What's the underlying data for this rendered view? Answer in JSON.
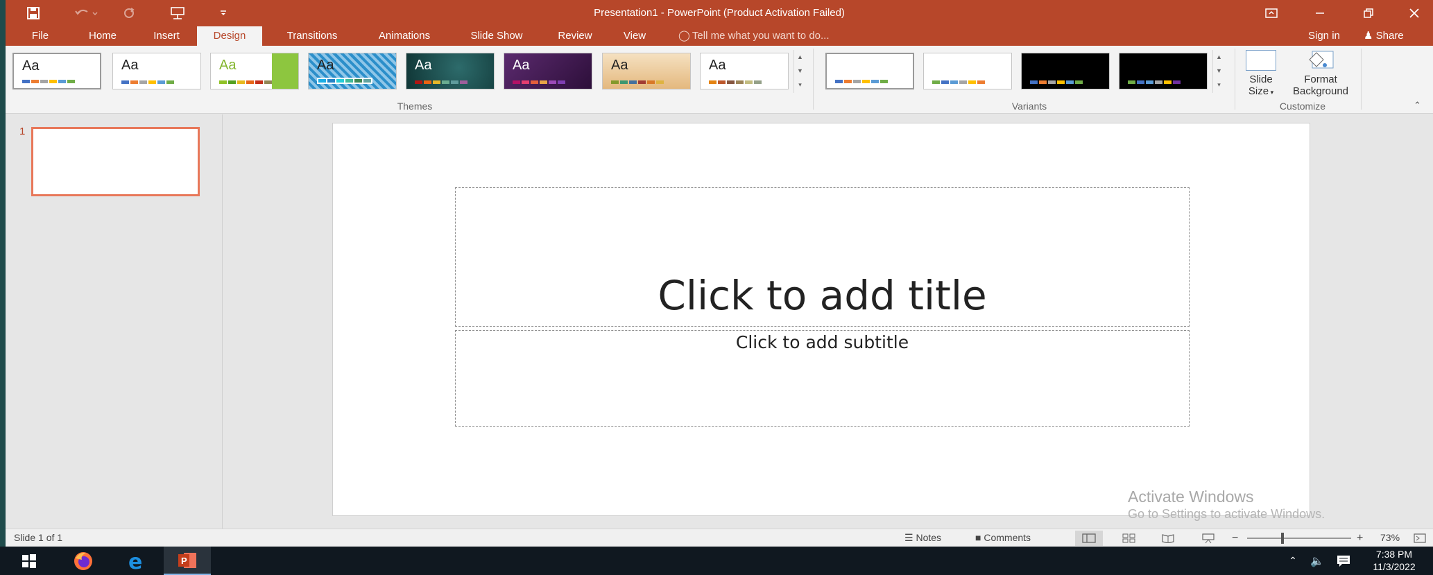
{
  "window": {
    "title": "Presentation1 - PowerPoint (Product Activation Failed)"
  },
  "tabs": [
    {
      "label": "File"
    },
    {
      "label": "Home"
    },
    {
      "label": "Insert"
    },
    {
      "label": "Design"
    },
    {
      "label": "Transitions"
    },
    {
      "label": "Animations"
    },
    {
      "label": "Slide Show"
    },
    {
      "label": "Review"
    },
    {
      "label": "View"
    }
  ],
  "active_tab": "Design",
  "tell_me": "Tell me what you want to do...",
  "sign_in": "Sign in",
  "share": "Share",
  "themes": {
    "group_label": "Themes",
    "thumb_text": "Aa"
  },
  "variants": {
    "group_label": "Variants"
  },
  "customize": {
    "group_label": "Customize",
    "slide_size_line1": "Slide",
    "slide_size_line2": "Size",
    "format_bg_line1": "Format",
    "format_bg_line2": "Background"
  },
  "thumbnails": {
    "slide_number": "1"
  },
  "slide": {
    "title_placeholder": "Click to add title",
    "subtitle_placeholder": "Click to add subtitle"
  },
  "watermark": {
    "line1": "Activate Windows",
    "line2": "Go to Settings to activate Windows."
  },
  "statusbar": {
    "slide_info": "Slide 1 of 1",
    "notes": "Notes",
    "comments": "Comments",
    "zoom_minus": "−",
    "zoom_plus": "+",
    "zoom_level": "73%"
  },
  "taskbar": {
    "time": "7:38 PM",
    "date": "11/3/2022"
  },
  "colors": {
    "accent": "#b7472a",
    "thumb_border": "#e8785a"
  }
}
